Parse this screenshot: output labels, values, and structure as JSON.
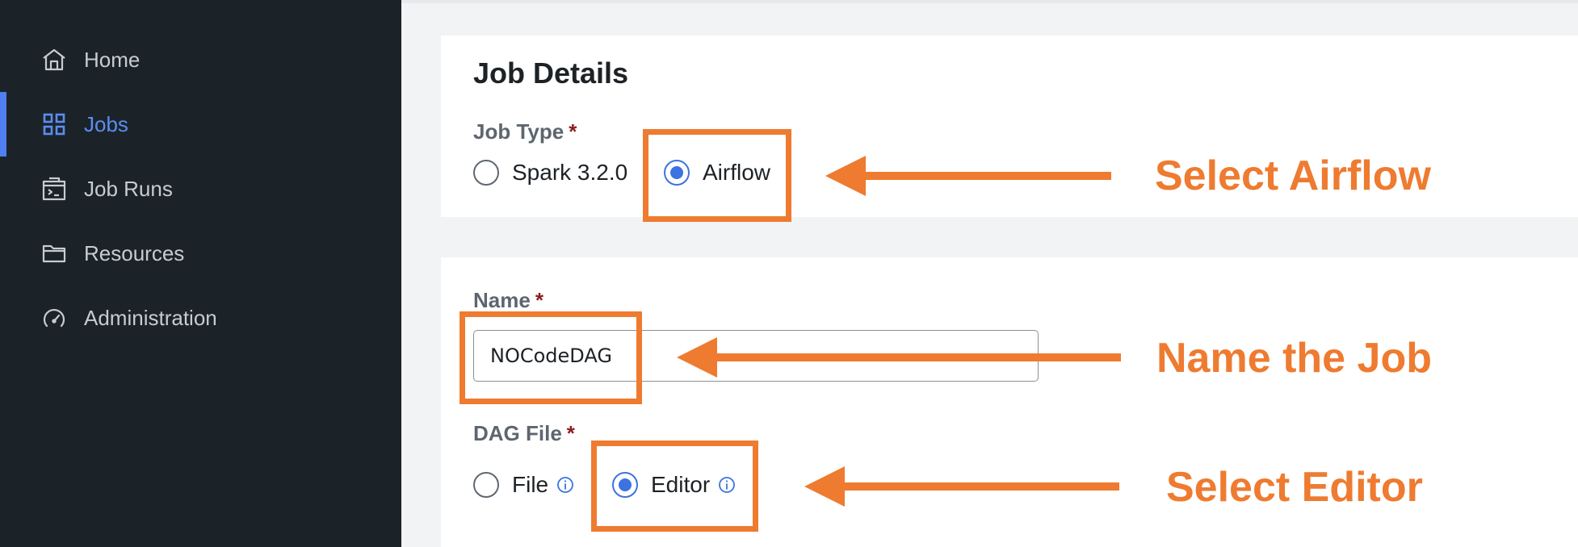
{
  "sidebar": {
    "items": [
      {
        "label": "Home",
        "icon": "home-icon"
      },
      {
        "label": "Jobs",
        "icon": "grid-icon",
        "active": true
      },
      {
        "label": "Job Runs",
        "icon": "terminal-icon"
      },
      {
        "label": "Resources",
        "icon": "folder-icon"
      },
      {
        "label": "Administration",
        "icon": "gauge-icon"
      }
    ],
    "active_color": "#5b8def",
    "background": "#1b2329"
  },
  "job_details": {
    "title": "Job Details",
    "job_type_label": "Job Type",
    "required_mark": "*",
    "options": [
      {
        "label": "Spark 3.2.0",
        "checked": false
      },
      {
        "label": "Airflow",
        "checked": true
      }
    ]
  },
  "job_form": {
    "name_label": "Name",
    "required_mark": "*",
    "name_value": "NOCodeDAG",
    "dag_file_label": "DAG File",
    "dag_options": [
      {
        "label": "File",
        "checked": false,
        "info_icon": "info-icon"
      },
      {
        "label": "Editor",
        "checked": true,
        "info_icon": "info-icon"
      }
    ]
  },
  "annotations": {
    "color": "#ee7b30",
    "select_airflow": "Select Airflow",
    "name_the_job": "Name the Job",
    "select_editor": "Select Editor"
  }
}
